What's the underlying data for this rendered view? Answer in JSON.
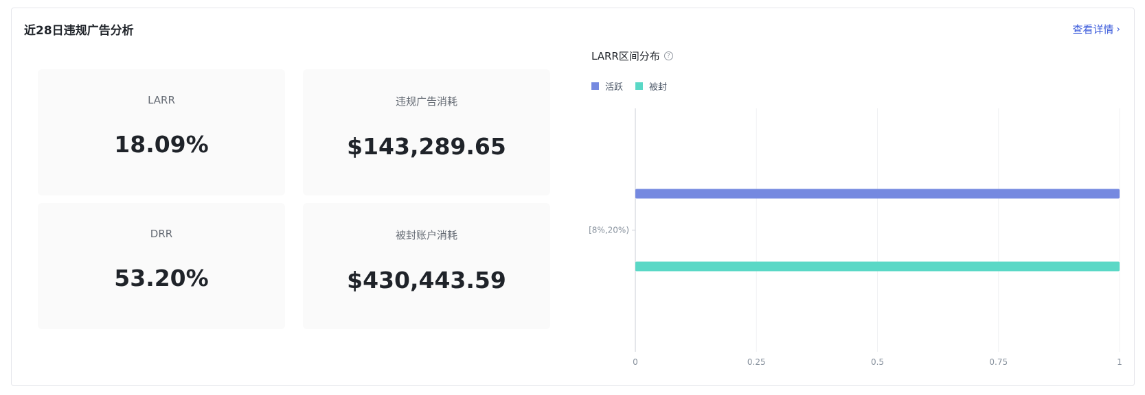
{
  "header": {
    "title": "近28日违规广告分析",
    "detail_link": "查看详情"
  },
  "metrics": [
    {
      "label": "LARR",
      "value": "18.09%"
    },
    {
      "label": "违规广告消耗",
      "value": "$143,289.65"
    },
    {
      "label": "DRR",
      "value": "53.20%"
    },
    {
      "label": "被封账户消耗",
      "value": "$430,443.59"
    }
  ],
  "chart_data": {
    "type": "bar",
    "orientation": "horizontal",
    "title": "LARR区间分布",
    "categories": [
      "[8%,20%)"
    ],
    "series": [
      {
        "name": "活跃",
        "values": [
          1
        ],
        "color": "#7589e0"
      },
      {
        "name": "被封",
        "values": [
          1
        ],
        "color": "#5ad8c6"
      }
    ],
    "xlim": [
      0,
      1
    ],
    "xticks": [
      "0",
      "0.25",
      "0.5",
      "0.75",
      "1"
    ],
    "grid": true,
    "legend_position": "top-left"
  }
}
